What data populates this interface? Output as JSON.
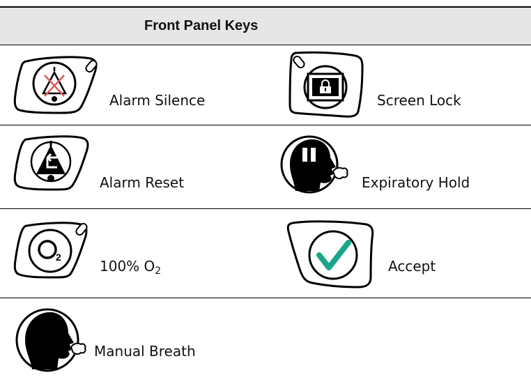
{
  "header": {
    "title": "Front Panel Keys"
  },
  "keys": [
    {
      "label": "Alarm Silence",
      "icon": "alarm-silence-icon"
    },
    {
      "label": "Screen Lock",
      "icon": "screen-lock-icon"
    },
    {
      "label": "Alarm Reset",
      "icon": "alarm-reset-icon"
    },
    {
      "label": "Expiratory Hold",
      "icon": "expiratory-hold-icon"
    },
    {
      "label_main": "100% O",
      "label_sub": "2",
      "icon": "oxygen-icon"
    },
    {
      "label": "Accept",
      "icon": "accept-check-icon",
      "accent": "#1aa58a"
    },
    {
      "label": "Manual Breath",
      "icon": "manual-breath-icon"
    }
  ]
}
